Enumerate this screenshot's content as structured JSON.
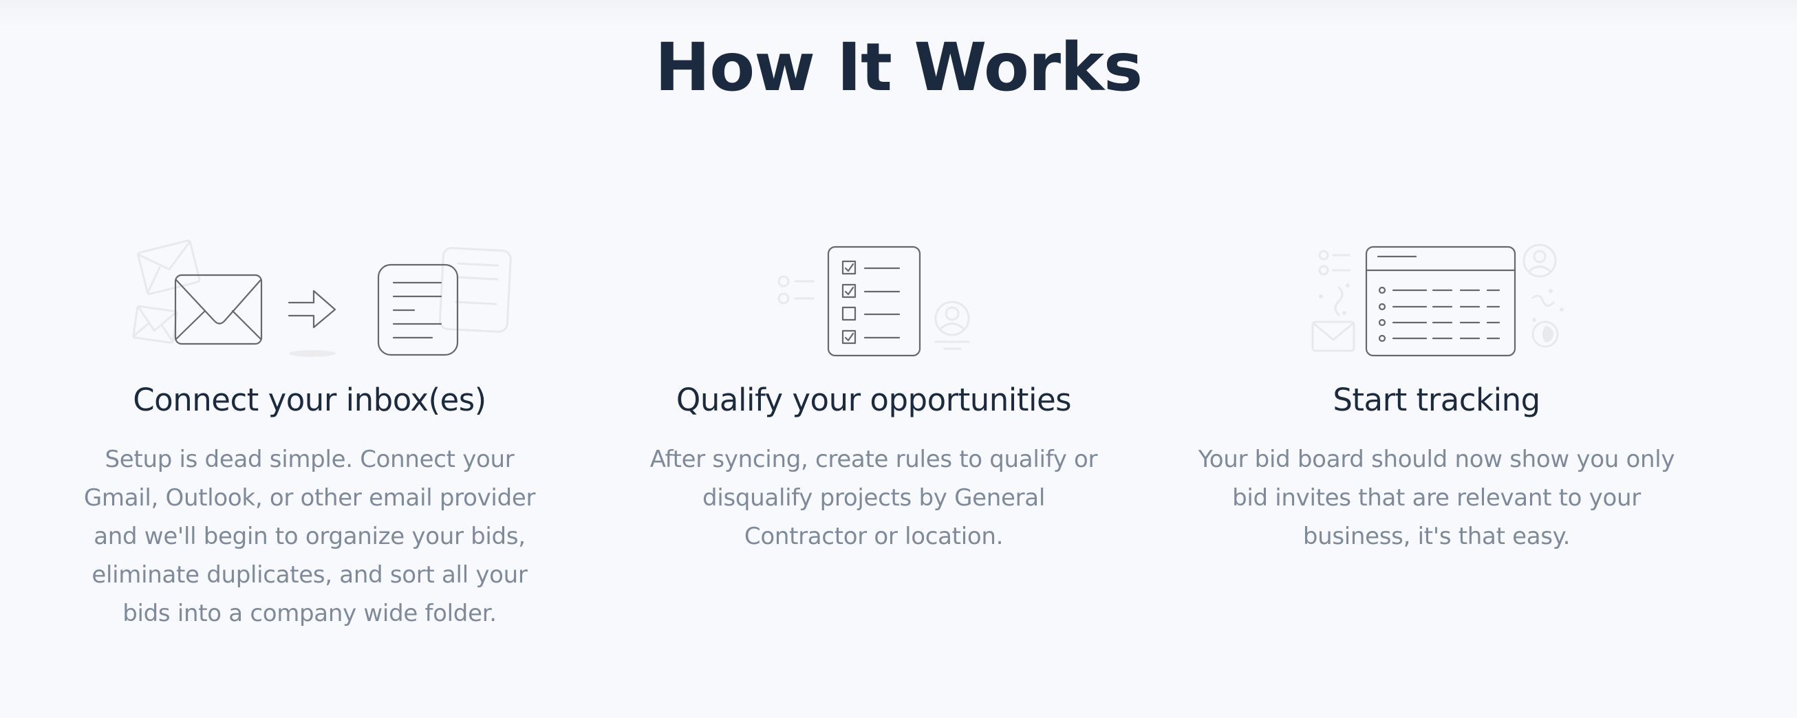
{
  "section": {
    "title": "How It Works"
  },
  "steps": [
    {
      "illustration": "inbox-to-document-illustration",
      "title": "Connect your inbox(es)",
      "text": "Setup is dead simple. Connect your Gmail, Outlook, or other email provider and we'll begin to organize your bids, eliminate duplicates, and sort all your bids into a company wide folder."
    },
    {
      "illustration": "checklist-illustration",
      "title": "Qualify your opportunities",
      "text": "After syncing, create rules to qualify or disqualify projects by General Contractor or location."
    },
    {
      "illustration": "bid-board-table-illustration",
      "title": "Start tracking",
      "text": "Your bid board should now show you only bid invites that are relevant to your business, it's that easy."
    }
  ],
  "colors": {
    "heading": "#1b2a3e",
    "body_text": "#7e8a9a",
    "icon_stroke": "#67676f",
    "icon_faded": "#e9e9ec",
    "background": "#f8f9fd"
  }
}
